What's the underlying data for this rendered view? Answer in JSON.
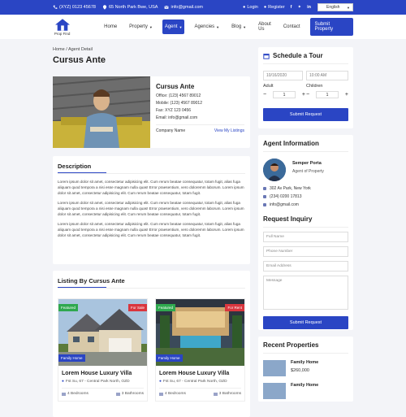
{
  "topbar": {
    "phone": "(XYZ) 0123 45678",
    "address": "65 North Park Bwe, USA",
    "email": "info@gmail.com",
    "login": "Login",
    "register": "Register",
    "language": "English"
  },
  "nav": {
    "logo_text": "Prop Find",
    "items": [
      {
        "label": "Home",
        "dropdown": false,
        "active": false
      },
      {
        "label": "Property",
        "dropdown": true,
        "active": false
      },
      {
        "label": "Agent",
        "dropdown": true,
        "active": true
      },
      {
        "label": "Agencies",
        "dropdown": true,
        "active": false
      },
      {
        "label": "Blog",
        "dropdown": true,
        "active": false
      },
      {
        "label": "About Us",
        "dropdown": false,
        "active": false
      },
      {
        "label": "Contact",
        "dropdown": false,
        "active": false
      }
    ],
    "submit_label": "Submit Property"
  },
  "breadcrumb": "Home / Agent Detail",
  "page_title": "Cursus Ante",
  "agent": {
    "name": "Cursus Ante",
    "office": "Office: (123) 4567 89012",
    "mobile": "Mobile: (123) 4567 89012",
    "fax": "Fax: XYZ 123 0456",
    "email": "Email: info@gmail.com",
    "company_label": "Company Name",
    "listings_link": "View My Listings"
  },
  "description": {
    "title": "Description",
    "paragraphs": [
      "Lorem ipsum dolor sit amet, consectetur adipisicing elit. Cum rerum beatae consequatur, totam fugit, alias fuga aliquam quod tempora a nisi esse magnam nulla quas! Error praesentium, vero doloremm laborum. Lorem ipsum dolor sit amet, consectetur adipisicing elit. Cum rerum beatae consequatur, totam fugit.",
      "Lorem ipsum dolor sit amet, consectetur adipisicing elit. Cum rerum beatae consequatur, totam fugit, alias fuga aliquam quod tempora a nisi esse magnam nulla quas! Error praesentium, vero doloremm laborum. Lorem ipsum dolor sit amet, consectetur adipisicing elit. Cum rerum beatae consequatur, totam fugit.",
      "Lorem ipsum dolor sit amet, consectetur adipisicing elit. Cum rerum beatae consequatur, totam fugit, alias fuga aliquam quod tempora a nisi esse magnam nulla quas! Error praesentium, vero doloremm laborum. Lorem ipsum dolor sit amet, consectetur adipisicing elit. Cum rerum beatae consequatur, totam fugit."
    ]
  },
  "listing": {
    "title": "Listing By Cursus Ante",
    "properties": [
      {
        "featured": "Featured",
        "status": "For Sale",
        "type": "Family Home",
        "title": "Lorem House Luxury Villa",
        "address": "Fst Su, 67 - Central Park North, OZD",
        "bedrooms": "4 Bedrooms",
        "bathrooms": "3 Bathrooms"
      },
      {
        "featured": "Featured",
        "status": "For Rent",
        "type": "Family Home",
        "title": "Lorem House Luxury Villa",
        "address": "Fst Su, 67 - Central Park North, OZD",
        "bedrooms": "4 Bedrooms",
        "bathrooms": "3 Bathrooms"
      }
    ]
  },
  "tour": {
    "title": "Schedule a Tour",
    "date": "10/16/2020",
    "time": "10:00 AM",
    "adult_label": "Adult",
    "children_label": "Children",
    "adult_value": "1",
    "children_value": "1",
    "button": "Submit Request"
  },
  "agent_info": {
    "title": "Agent Information",
    "name": "Semper Porta",
    "role": "Agent of Property",
    "address": "302 Av Park, New York",
    "phone": "(234) 0200 17813",
    "email": "info@gmail.com"
  },
  "inquiry": {
    "title": "Request Inquiry",
    "name_placeholder": "Full Name",
    "phone_placeholder": "Phone Number",
    "email_placeholder": "Email Address",
    "message_placeholder": "Message",
    "button": "Submit Request"
  },
  "recent": {
    "title": "Recent Properties",
    "items": [
      {
        "name": "Family Home",
        "price": "$260,000"
      },
      {
        "name": "Family Home",
        "price": ""
      }
    ]
  },
  "colors": {
    "primary": "#2a45c4",
    "featured": "#2fa84f",
    "status": "#d9363e"
  }
}
